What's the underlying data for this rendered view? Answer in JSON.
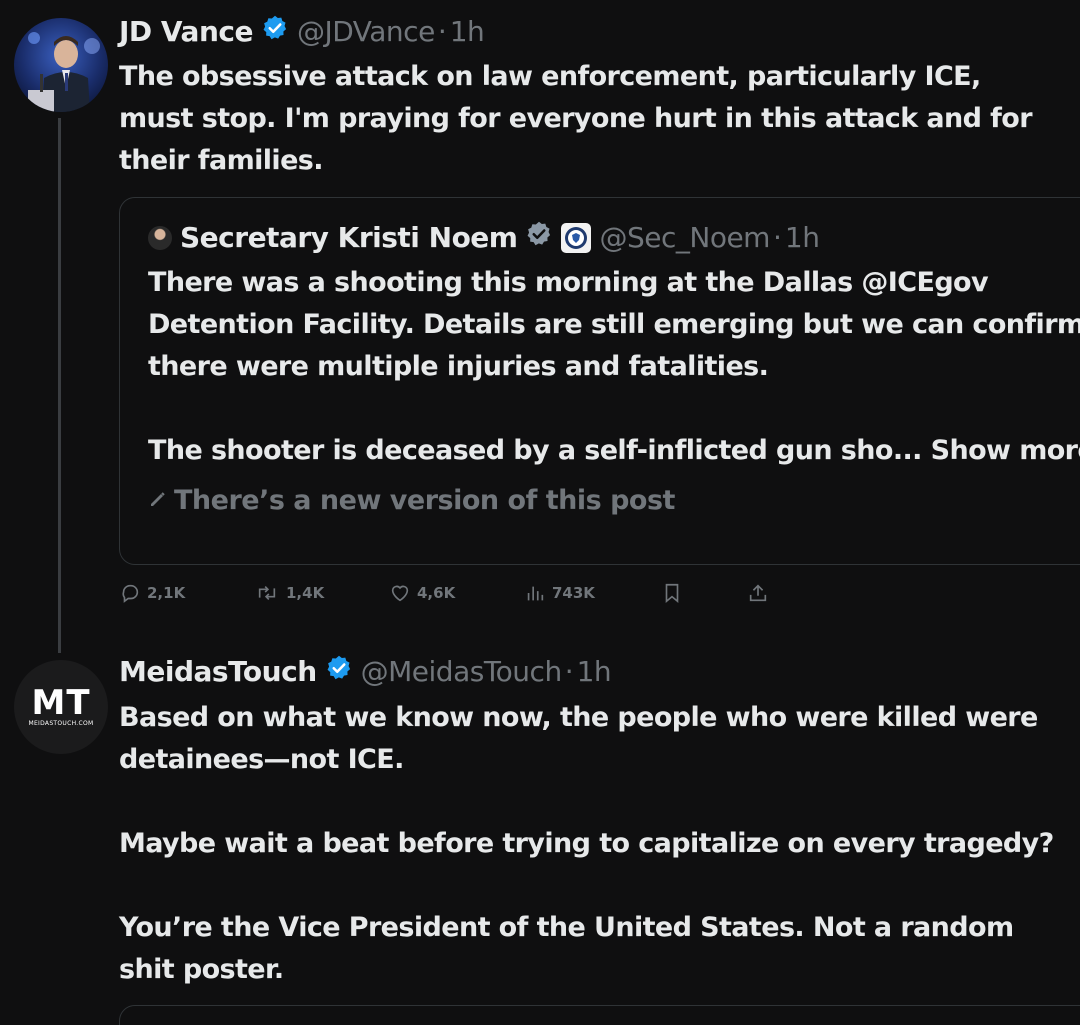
{
  "tweet1": {
    "name": "JD Vance",
    "handle": "@JDVance",
    "dot": "·",
    "time": "1h",
    "text": "The obsessive attack on law enforcement, particularly ICE, must stop. I'm praying for everyone hurt in this attack and for their families.",
    "quote": {
      "name": "Secretary Kristi Noem",
      "handle": "@Sec_Noem",
      "dot": "·",
      "time": "1h",
      "text": "There was a shooting this morning at the Dallas @ICEgov Detention Facility. Details are still emerging but we can confirm there were multiple injuries and fatalities.\n\nThe shooter is deceased by a self-inflicted gun sho...",
      "show_more": "Show more",
      "new_version": "There’s a new version of this post"
    },
    "actions": {
      "replies": "2,1K",
      "reposts": "1,4K",
      "likes": "4,6K",
      "views": "743K"
    }
  },
  "tweet2": {
    "name": "MeidasTouch",
    "handle": "@MeidasTouch",
    "dot": "·",
    "time": "1h",
    "avatar_logo": "MT",
    "avatar_sub": "MEIDASTOUCH.COM",
    "text": "Based on what we know now, the people who were killed were detainees—not ICE.\n\nMaybe wait a beat before trying to capitalize on every tragedy?\n\nYou’re the Vice President of the United States. Not a random shit poster."
  },
  "colors": {
    "background": "#0f0f10",
    "text": "#e7e9ea",
    "muted": "#71767b",
    "verified": "#1d9bf0",
    "border": "#2f3336"
  }
}
